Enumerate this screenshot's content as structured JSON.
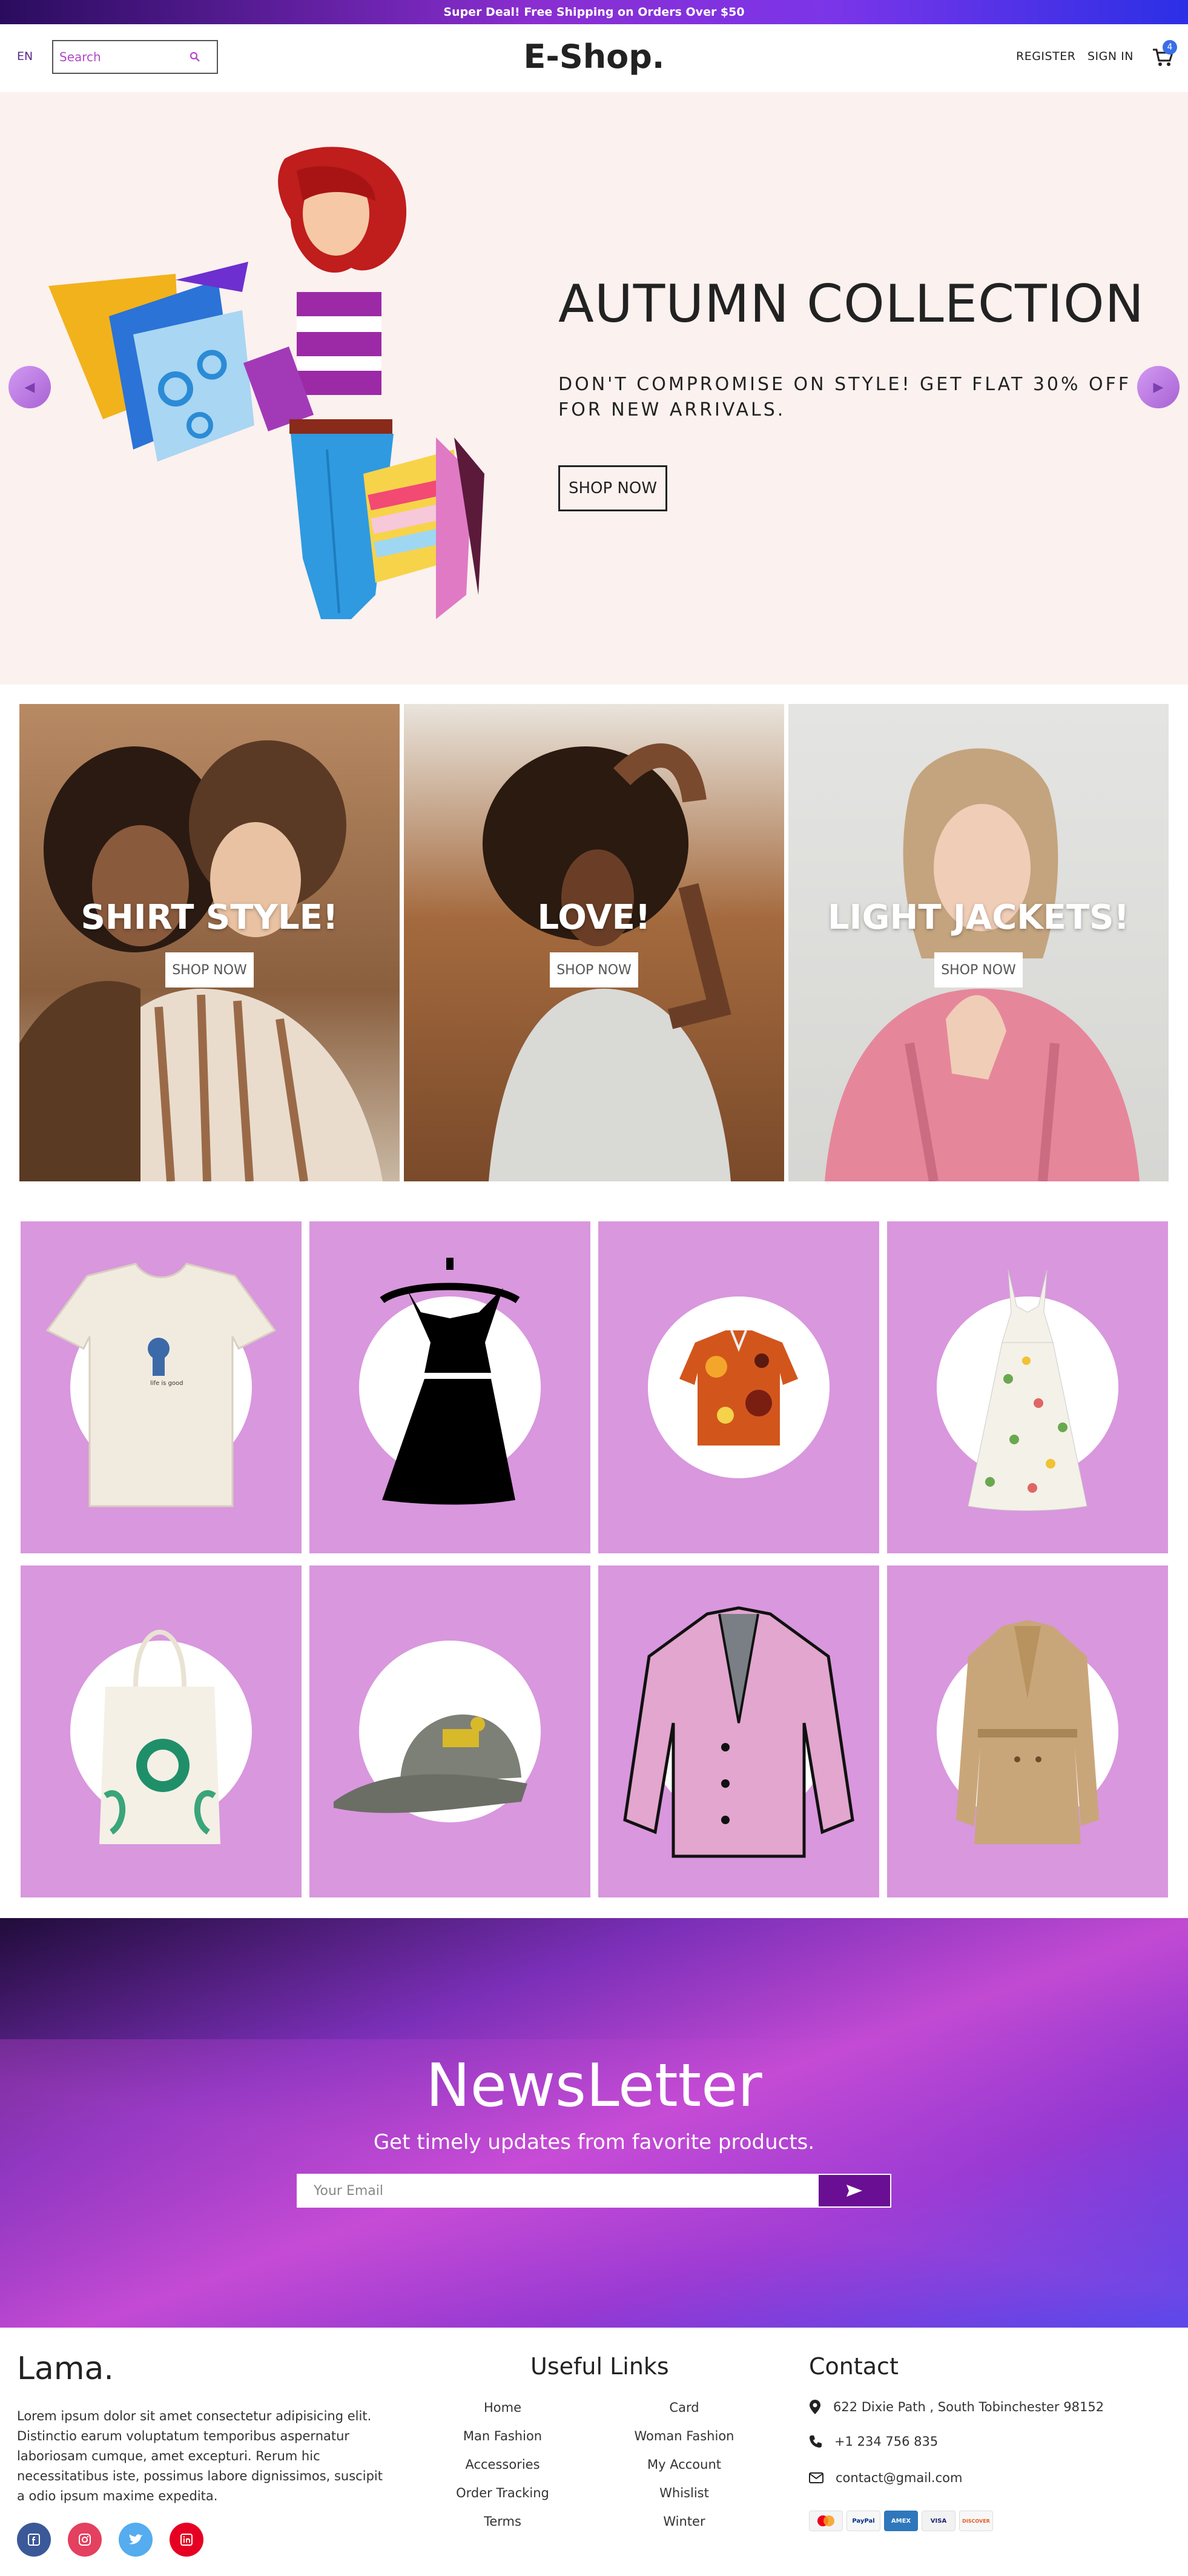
{
  "announcement": "Super Deal! Free Shipping on Orders Over $50",
  "nav": {
    "language": "EN",
    "search_placeholder": "Search",
    "brand": "E-Shop.",
    "register": "REGISTER",
    "sign_in": "SIGN IN",
    "cart_count": "4"
  },
  "hero": {
    "title": "AUTUMN COLLECTION",
    "description": "DON'T COMPROMISE ON STYLE! GET FLAT 30% OFF FOR NEW ARRIVALS.",
    "button": "SHOP NOW"
  },
  "categories": [
    {
      "title": "SHIRT STYLE!",
      "button": "SHOP NOW"
    },
    {
      "title": "LOVE!",
      "button": "SHOP NOW"
    },
    {
      "title": "LIGHT JACKETS!",
      "button": "SHOP NOW"
    }
  ],
  "products": [
    "t-shirt",
    "black-dress",
    "hawaiian-shirt",
    "floral-dress",
    "tote-bag",
    "cap",
    "pink-jacket",
    "trench-coat"
  ],
  "newsletter": {
    "title": "NewsLetter",
    "subtitle": "Get timely updates from favorite products.",
    "email_placeholder": "Your Email"
  },
  "footer": {
    "brand": "Lama.",
    "description": "Lorem ipsum dolor sit amet consectetur adipisicing elit. Distinctio earum voluptatum temporibus aspernatur laboriosam cumque, amet excepturi. Rerum hic necessitatibus iste, possimus labore dignissimos, suscipit a odio ipsum maxime expedita.",
    "useful_links_title": "Useful Links",
    "links_left": [
      "Home",
      "Man Fashion",
      "Accessories",
      "Order Tracking",
      "Terms"
    ],
    "links_right": [
      "Card",
      "Woman Fashion",
      "My Account",
      "Whislist",
      "Winter"
    ],
    "contact_title": "Contact",
    "address": "622 Dixie Path , South Tobinchester 98152",
    "phone": "+1 234 756 835",
    "email": "contact@gmail.com",
    "payment_methods": [
      "MasterCard",
      "PayPal",
      "AMEX",
      "VISA",
      "DISCOVER"
    ]
  },
  "colors": {
    "product_bg": "#d997de",
    "hero_bg": "#fbf1ef",
    "newsletter_button": "#6a0f93"
  }
}
